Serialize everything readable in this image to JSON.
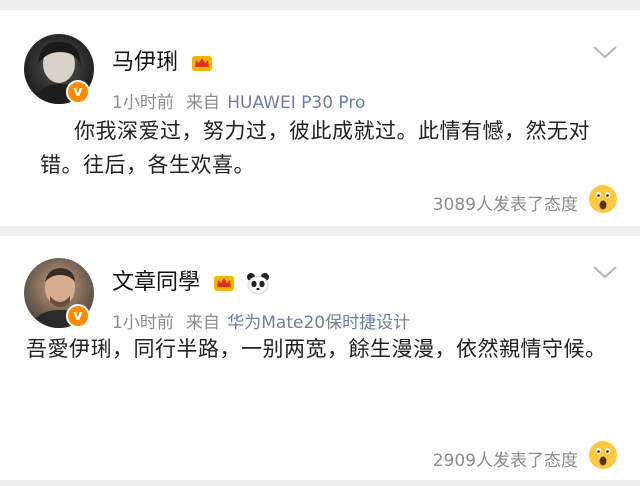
{
  "posts": [
    {
      "username": "马伊琍",
      "time": "1小时前",
      "from_label": "来自",
      "source": "HUAWEI P30 Pro",
      "content": "你我深爱过，努力过，彼此成就过。此情有憾，然无对错。往后，各生欢喜。",
      "reactions": "3089人发表了态度",
      "icons": [
        "avatar",
        "verified-badge-icon",
        "crown-icon",
        "chevron-down-icon",
        "wow-emoji-icon"
      ]
    },
    {
      "username": "文章同學",
      "time": "1小时前",
      "from_label": "来自",
      "source": "华为Mate20保时捷设计",
      "content": "吾愛伊琍，同行半路，一别两宽，餘生漫漫，依然親情守候。",
      "reactions": "2909人发表了态度",
      "icons": [
        "avatar",
        "verified-badge-icon",
        "crown-icon",
        "panda-icon",
        "chevron-down-icon",
        "wow-emoji-icon"
      ]
    }
  ],
  "colors": {
    "background": "#efefef",
    "card": "#ffffff",
    "meta_text": "#8c8c8c",
    "source_link": "#6b7fa3",
    "badge": "#ff8c00"
  }
}
